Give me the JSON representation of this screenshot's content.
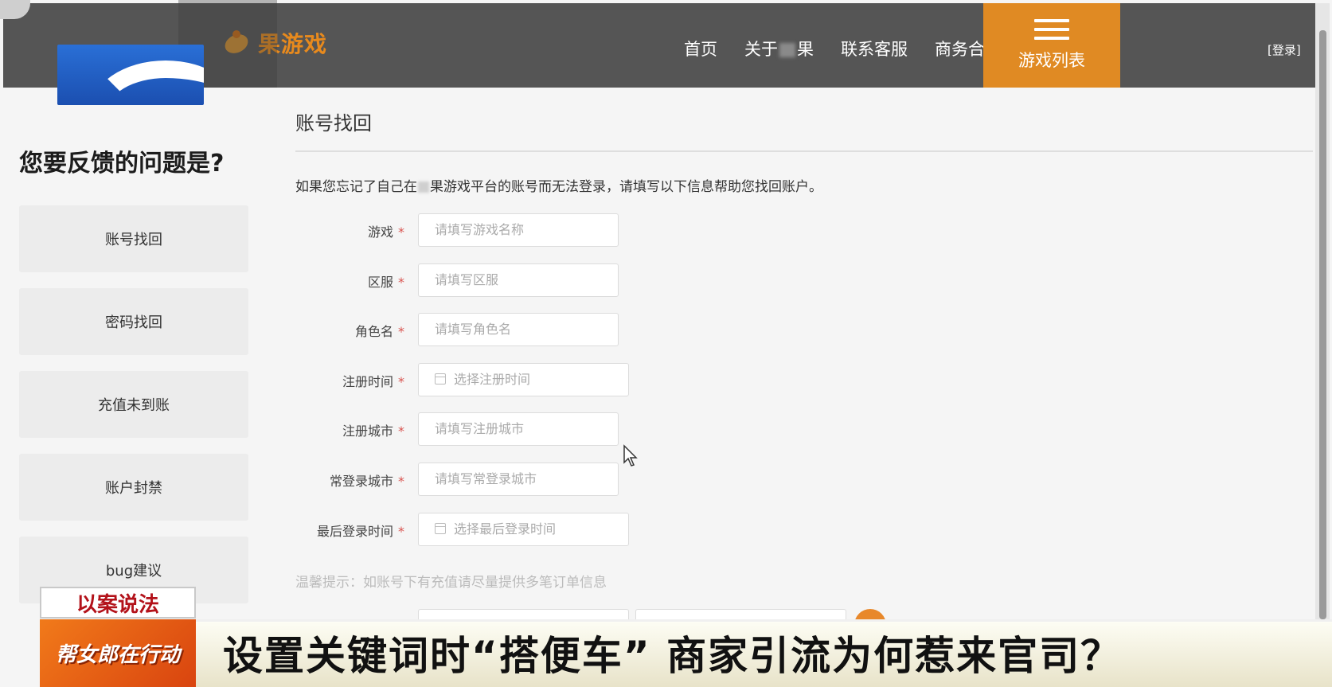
{
  "header": {
    "logo_text": "果游戏",
    "nav": [
      "首页",
      "关于",
      "果",
      "联系客服",
      "商务合作"
    ],
    "game_list": "游戏列表",
    "login": "[登录]"
  },
  "sidebar": {
    "title": "您要反馈的问题是?",
    "items": [
      "账号找回",
      "密码找回",
      "充值未到账",
      "账户封禁",
      "bug建议"
    ]
  },
  "main": {
    "title": "账号找回",
    "intro_pre": "如果您忘记了自己在",
    "intro_post": "果游戏平台的账号而无法登录，请填写以下信息帮助您找回账户。",
    "fields": [
      {
        "label": "游戏",
        "placeholder": "请填写游戏名称"
      },
      {
        "label": "区服",
        "placeholder": "请填写区服"
      },
      {
        "label": "角色名",
        "placeholder": "请填写角色名"
      },
      {
        "label": "注册时间",
        "placeholder": "选择注册时间"
      },
      {
        "label": "注册城市",
        "placeholder": "请填写注册城市"
      },
      {
        "label": "常登录城市",
        "placeholder": "请填写常登录城市"
      },
      {
        "label": "最后登录时间",
        "placeholder": "选择最后登录时间"
      }
    ],
    "required_mark": "*",
    "tip": "温馨提示：如账号下有充值请尽量提供多笔订单信息"
  },
  "overlay": {
    "case_tag": "以案说法",
    "program_logo": "帮女郎在行动",
    "headline": "设置关键词时“搭便车” 商家引流为何惹来官司？"
  },
  "colors": {
    "nav_bg": "#555555",
    "accent": "#e08a23",
    "required": "#d9534f"
  }
}
